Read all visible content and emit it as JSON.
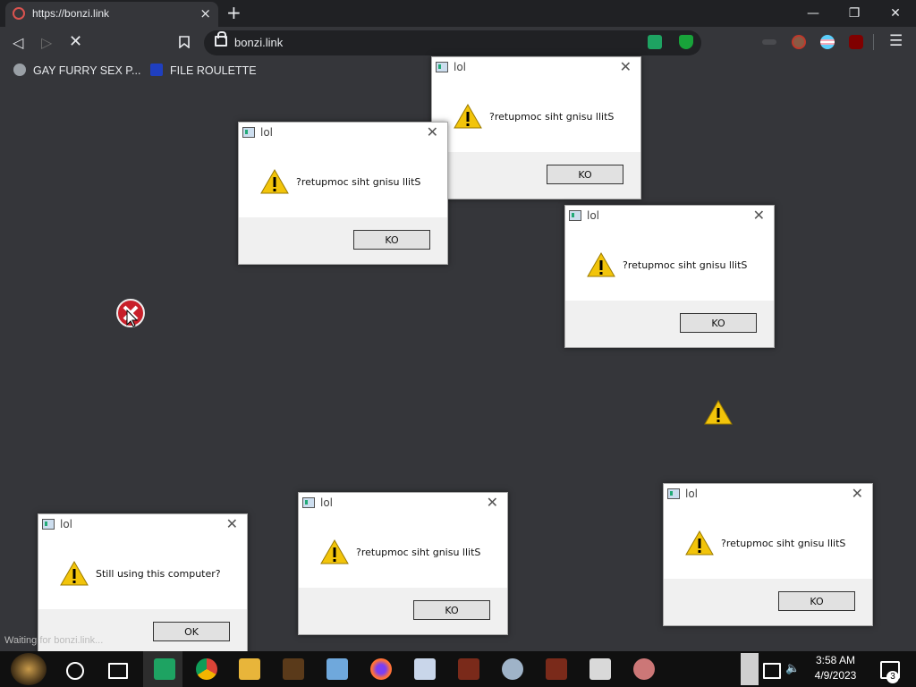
{
  "browser": {
    "tab_title": "https://bonzi.link",
    "url": "bonzi.link",
    "new_tab": "+",
    "tab_close": "×",
    "window_controls": {
      "minimize": "—",
      "maximize": "❐",
      "close": "✕"
    },
    "bookmarks": [
      {
        "label": "GAY FURRY SEX P...",
        "icon": "globe-icon"
      },
      {
        "label": "FILE ROULETTE",
        "icon": "mft-icon"
      }
    ],
    "status_text": "Waiting for bonzi.link..."
  },
  "dialogs": [
    {
      "title": "lol",
      "message": "?retupmoc siht gnisu llitS",
      "button": "KO"
    },
    {
      "title": "lol",
      "message": "?retupmoc siht gnisu llitS",
      "button": "KO"
    },
    {
      "title": "lol",
      "message": "?retupmoc siht gnisu llitS",
      "button": "KO"
    },
    {
      "title": "lol",
      "message": "Still using this computer?",
      "button": "OK"
    },
    {
      "title": "lol",
      "message": "?retupmoc siht gnisu llitS",
      "button": "KO"
    },
    {
      "title": "lol",
      "message": "?retupmoc siht gnisu llitS",
      "button": "KO"
    }
  ],
  "taskbar": {
    "time": "3:58 AM",
    "date": "4/9/2023",
    "notification_count": "3",
    "icons": [
      "start-icon",
      "cortana-icon",
      "task-view-icon",
      "sheets-icon",
      "chrome-icon",
      "explorer-icon",
      "app-icon",
      "notepad-icon",
      "firefox-icon",
      "wordpad-icon",
      "video-icon",
      "paint-icon",
      "video-icon",
      "calculator-icon",
      "paint-alt-icon"
    ]
  },
  "colors": {
    "page_bg": "#35363a",
    "titlebar_bg": "#202124",
    "taskbar_bg": "#101010",
    "dialog_bg": "#f0f0f0",
    "warning_yellow": "#f2c40a"
  }
}
